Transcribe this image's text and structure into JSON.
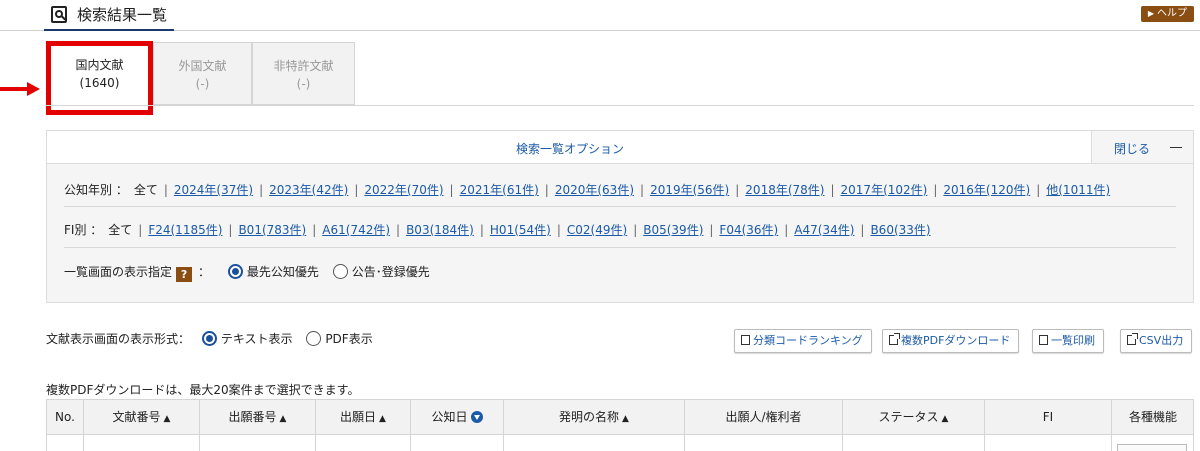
{
  "header": {
    "title": "検索結果一覧",
    "help_label": "ヘルプ"
  },
  "tabs": [
    {
      "label": "国内文献",
      "count": "(1640)",
      "active": true
    },
    {
      "label": "外国文献",
      "count": "(-)",
      "active": false
    },
    {
      "label": "非特許文献",
      "count": "(-)",
      "active": false
    }
  ],
  "options": {
    "title": "検索一覧オプション",
    "close_label": "閉じる",
    "year_filter": {
      "label": "公知年別 ：",
      "all": "全て",
      "items": [
        "2024年(37件)",
        "2023年(42件)",
        "2022年(70件)",
        "2021年(61件)",
        "2020年(63件)",
        "2019年(56件)",
        "2018年(78件)",
        "2017年(102件)",
        "2016年(120件)",
        "他(1011件)"
      ]
    },
    "fi_filter": {
      "label": "FI別 ：",
      "all": "全て",
      "items": [
        "F24(1185件)",
        "B01(783件)",
        "A61(742件)",
        "B03(184件)",
        "H01(54件)",
        "C02(49件)",
        "B05(39件)",
        "F04(36件)",
        "A47(34件)",
        "B60(33件)"
      ]
    },
    "display_order": {
      "label": "一覧画面の表示指定",
      "help_glyph": "?",
      "colon": "：",
      "options": [
        {
          "label": "最先公知優先",
          "selected": true
        },
        {
          "label": "公告･登録優先",
          "selected": false
        }
      ]
    }
  },
  "display_format": {
    "label": "文献表示画面の表示形式：",
    "options": [
      {
        "label": "テキスト表示",
        "selected": true
      },
      {
        "label": "PDF表示",
        "selected": false
      }
    ]
  },
  "toolbar": {
    "ranking": "分類コードランキング",
    "multi_pdf": "複数PDFダウンロード",
    "print": "一覧印刷",
    "csv": "CSV出力"
  },
  "note": "複数PDFダウンロードは、最大20案件まで選択できます。",
  "table": {
    "columns": [
      {
        "label": "No.",
        "sort": ""
      },
      {
        "label": "文献番号",
        "sort": "▲"
      },
      {
        "label": "出願番号",
        "sort": "▲"
      },
      {
        "label": "出願日",
        "sort": "▲"
      },
      {
        "label": "公知日",
        "sort": "down"
      },
      {
        "label": "発明の名称",
        "sort": "▲"
      },
      {
        "label": "出願人/権利者",
        "sort": ""
      },
      {
        "label": "ステータス",
        "sort": "▲"
      },
      {
        "label": "FI",
        "sort": ""
      },
      {
        "label": "各種機能",
        "sort": ""
      }
    ]
  },
  "colors": {
    "accent_blue": "#1b5aa8",
    "highlight_red": "#e30000",
    "help_brown": "#8a4d12"
  }
}
